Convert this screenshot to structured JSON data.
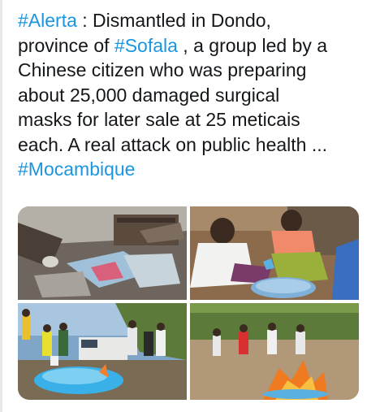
{
  "tweet": {
    "lines": [
      [
        {
          "text": "#Alerta",
          "tag": true
        },
        {
          "text": " : Dismantled in Dondo,",
          "tag": false
        }
      ],
      [
        {
          "text": "province of ",
          "tag": false
        },
        {
          "text": "#Sofala",
          "tag": true
        },
        {
          "text": " , a group led by a",
          "tag": false
        }
      ],
      [
        {
          "text": "Chinese citizen who was preparing",
          "tag": false
        }
      ],
      [
        {
          "text": "about 25,000 damaged surgical",
          "tag": false
        }
      ],
      [
        {
          "text": "masks for later sale at 25 meticais",
          "tag": false
        }
      ],
      [
        {
          "text": "each. A real attack on public health ...",
          "tag": false
        }
      ],
      [
        {
          "text": "#Mocambique",
          "tag": true
        }
      ]
    ]
  },
  "colors": {
    "hashtag": "#1b95e0",
    "text": "#14171a"
  },
  "media": {
    "photos": [
      {
        "icon": "rubble-with-masks-photo"
      },
      {
        "icon": "women-sorting-masks-photo"
      },
      {
        "icon": "officers-with-blue-masks-photo"
      },
      {
        "icon": "burning-masks-photo"
      }
    ]
  }
}
